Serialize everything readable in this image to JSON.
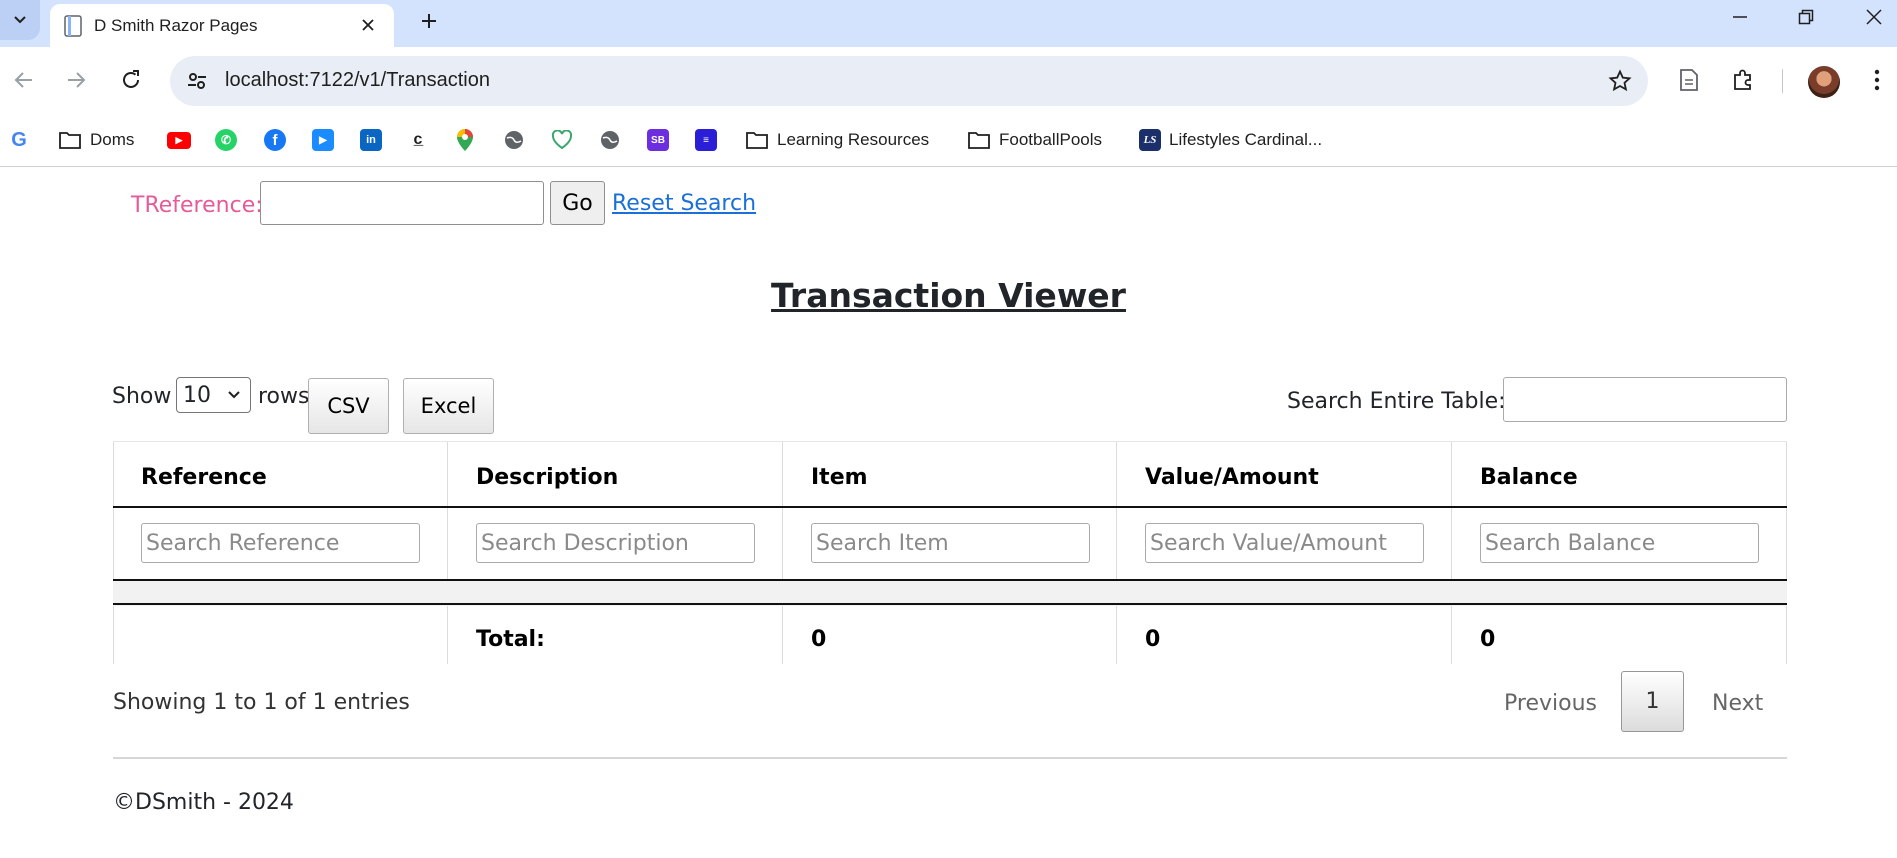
{
  "browser": {
    "tab_title": "D Smith Razor Pages",
    "url": "localhost:7122/v1/Transaction",
    "bookmarks": [
      {
        "label": "",
        "icon": "google-icon"
      },
      {
        "label": "Doms",
        "icon": "folder-icon"
      },
      {
        "label": "",
        "icon": "youtube-icon"
      },
      {
        "label": "",
        "icon": "whatsapp-icon"
      },
      {
        "label": "",
        "icon": "facebook-icon"
      },
      {
        "label": "",
        "icon": "play-icon"
      },
      {
        "label": "",
        "icon": "linkedin-icon"
      },
      {
        "label": "",
        "icon": "codepen-icon"
      },
      {
        "label": "",
        "icon": "maps-icon"
      },
      {
        "label": "",
        "icon": "globe-icon"
      },
      {
        "label": "",
        "icon": "heart-icon"
      },
      {
        "label": "",
        "icon": "globe-icon"
      },
      {
        "label": "SB",
        "icon": "sb-icon"
      },
      {
        "label": "",
        "icon": "grid-icon"
      },
      {
        "label": "Learning Resources",
        "icon": "folder-icon"
      },
      {
        "label": "FootballPools",
        "icon": "folder-icon"
      },
      {
        "label": "Lifestyles Cardinal...",
        "icon": "ls-icon"
      }
    ],
    "ls_badge": "LS"
  },
  "search_bar": {
    "label": "TReference:",
    "input_value": "",
    "go_label": "Go",
    "reset_label": "Reset Search"
  },
  "page_title": "Transaction Viewer",
  "controls": {
    "show_label": "Show",
    "rows_value": "10",
    "rows_label": "rows",
    "csv_label": "CSV",
    "excel_label": "Excel",
    "search_label": "Search Entire Table:",
    "search_value": ""
  },
  "table": {
    "columns": [
      {
        "header": "Reference",
        "placeholder": "Search Reference",
        "total": ""
      },
      {
        "header": "Description",
        "placeholder": "Search Description",
        "total": "Total:"
      },
      {
        "header": "Item",
        "placeholder": "Search Item",
        "total": "0"
      },
      {
        "header": "Value/Amount",
        "placeholder": "Search Value/Amount",
        "total": "0"
      },
      {
        "header": "Balance",
        "placeholder": "Search Balance",
        "total": "0"
      }
    ]
  },
  "pagination": {
    "info": "Showing 1 to 1 of 1 entries",
    "previous": "Previous",
    "current": "1",
    "next": "Next"
  },
  "footer": "©DSmith - 2024",
  "colors": {
    "tref_label": "#e75a9a",
    "link": "#1a6fd8",
    "tabstrip": "#d3e3fd"
  }
}
